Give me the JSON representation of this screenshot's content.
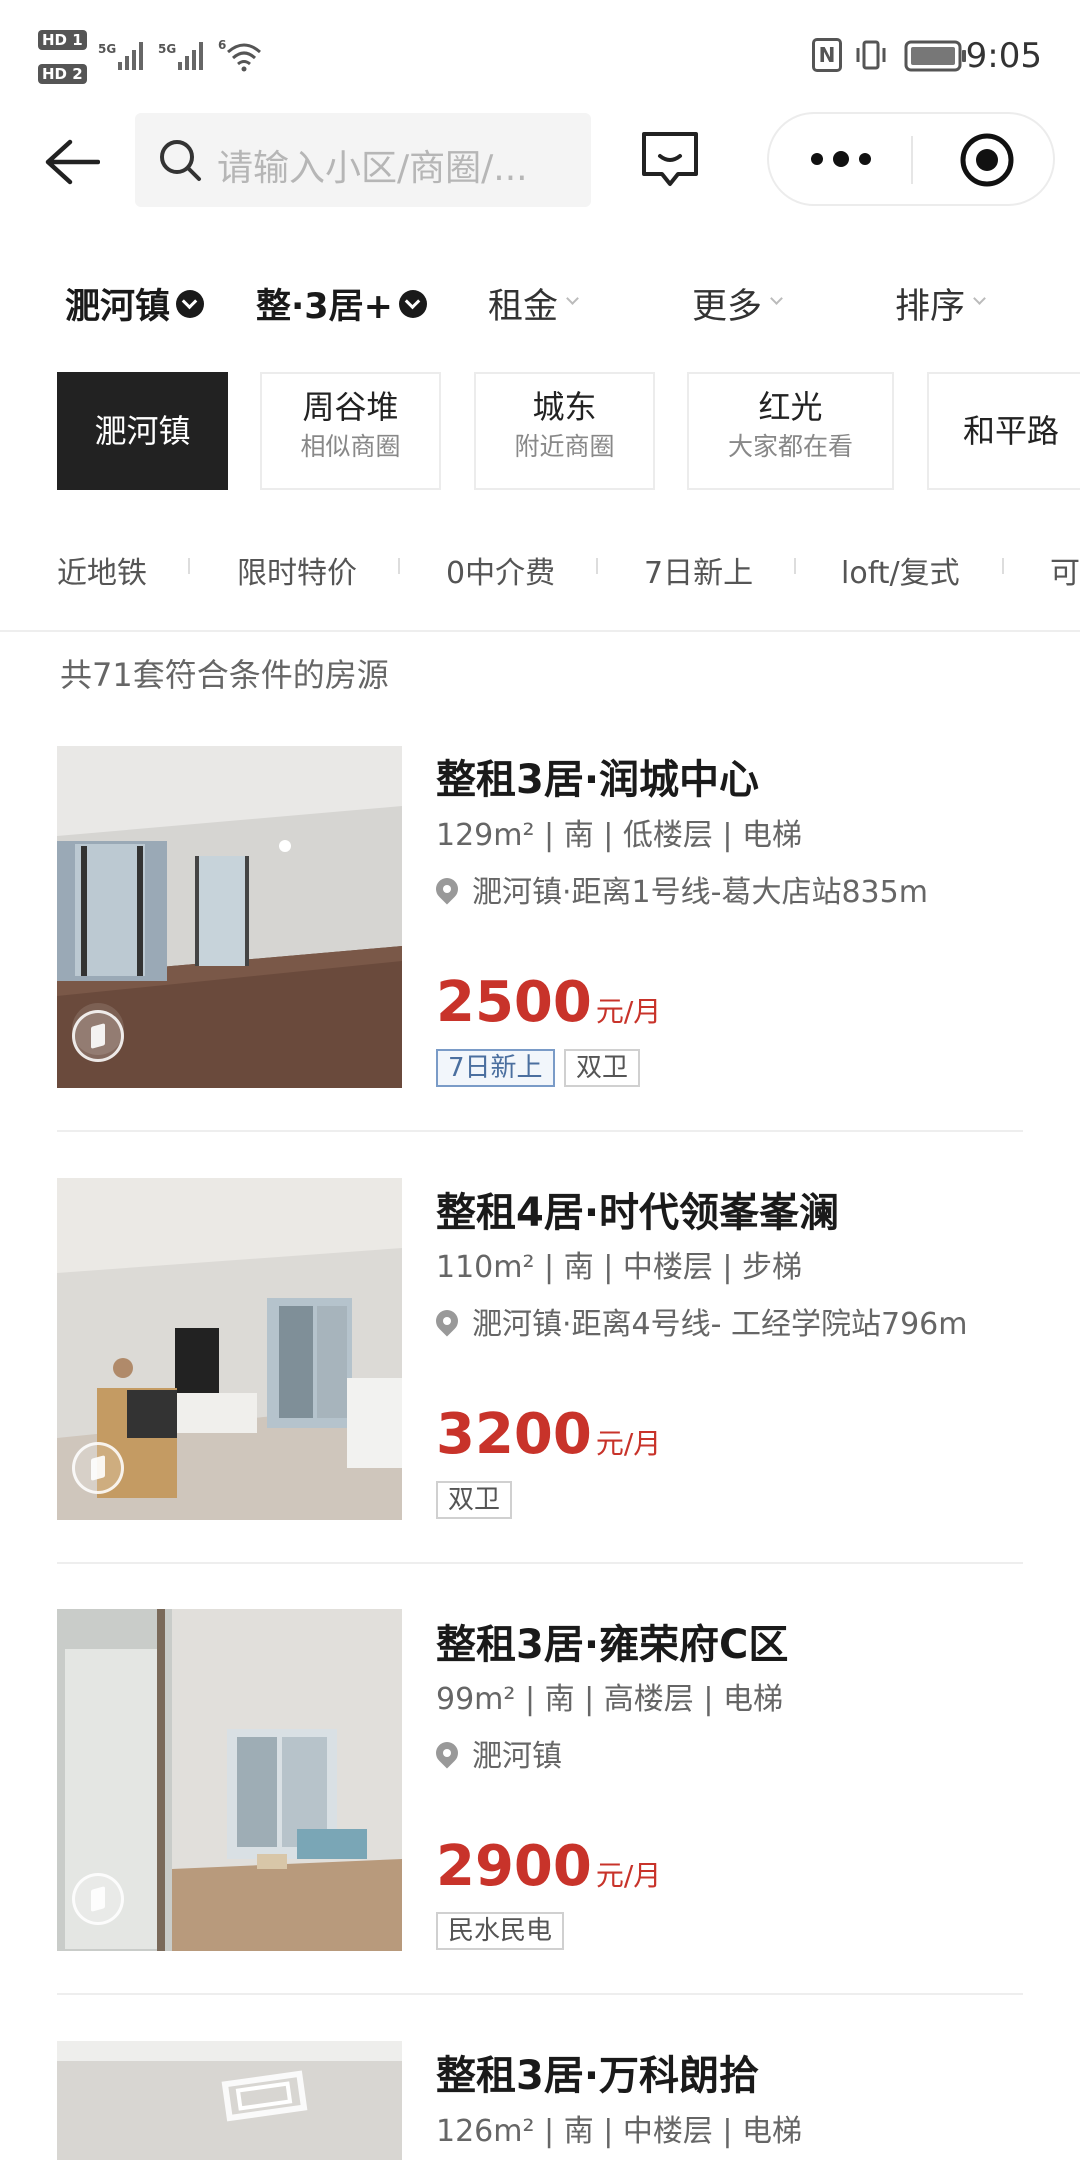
{
  "status_bar": {
    "hd1": "HD 1",
    "hd2": "HD 2",
    "net1": "5G",
    "net2": "5G",
    "wifi_num": "6",
    "nfc": "N",
    "time": "9:05"
  },
  "nav": {
    "search_placeholder": "请输入小区/商圈/..."
  },
  "filters": [
    {
      "label": "淝河镇",
      "selected": true
    },
    {
      "label": "整·3居+",
      "selected": true
    },
    {
      "label": "租金",
      "selected": false
    },
    {
      "label": "更多",
      "selected": false
    },
    {
      "label": "排序",
      "selected": false
    }
  ],
  "area_chips": [
    {
      "title": "淝河镇",
      "subtitle": "",
      "active": true
    },
    {
      "title": "周谷堆",
      "subtitle": "相似商圈",
      "active": false
    },
    {
      "title": "城东",
      "subtitle": "附近商圈",
      "active": false
    },
    {
      "title": "红光",
      "subtitle": "大家都在看",
      "active": false
    },
    {
      "title": "和平路",
      "subtitle": "",
      "active": false
    }
  ],
  "tags": [
    "近地铁",
    "限时特价",
    "0中介费",
    "7日新上",
    "loft/复式",
    "可"
  ],
  "result_count": "共71套符合条件的房源",
  "listings": [
    {
      "title": "整租3居·润城中心",
      "meta": "129m² | 南 | 低楼层 | 电梯",
      "location": "淝河镇·距离1号线-葛大店站835m",
      "price": "2500",
      "unit": "元/月",
      "badges": [
        {
          "text": "7日新上",
          "style": "blue"
        },
        {
          "text": "双卫",
          "style": "gray"
        }
      ]
    },
    {
      "title": "整租4居·时代领峯峯澜",
      "meta": "110m² | 南 | 中楼层 | 步梯",
      "location": "淝河镇·距离4号线- 工经学院站796m",
      "price": "3200",
      "unit": "元/月",
      "badges": [
        {
          "text": "双卫",
          "style": "gray"
        }
      ]
    },
    {
      "title": "整租3居·雍荣府C区",
      "meta": "99m² | 南 | 高楼层 | 电梯",
      "location": "淝河镇",
      "price": "2900",
      "unit": "元/月",
      "badges": [
        {
          "text": "民水民电",
          "style": "gray"
        }
      ]
    },
    {
      "title": "整租3居·万科朗拾",
      "meta": "126m² | 南 | 中楼层 | 电梯"
    }
  ],
  "colors": {
    "price_red": "#c8332a",
    "chip_active_bg": "#222222",
    "badge_blue": "#4b6f9f"
  }
}
